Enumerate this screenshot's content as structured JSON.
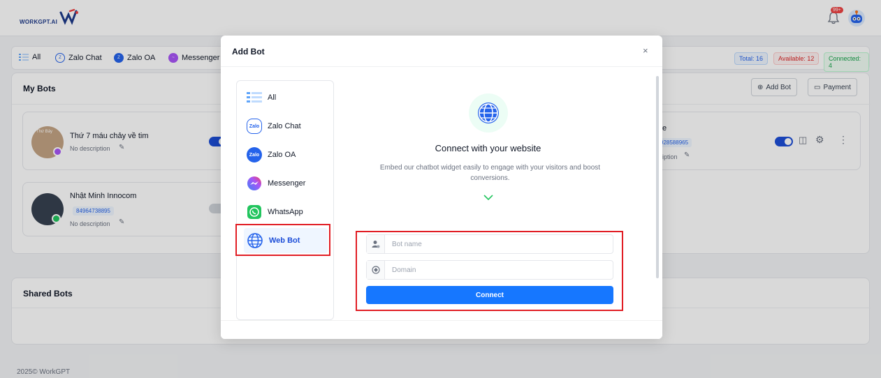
{
  "header": {
    "logo_text": "WORKGPT.AI",
    "notification_badge": "99+"
  },
  "filters": {
    "items": [
      {
        "label": "All",
        "icon": "list-icon"
      },
      {
        "label": "Zalo Chat",
        "icon": "zalo-chat-icon"
      },
      {
        "label": "Zalo OA",
        "icon": "zalo-oa-icon"
      },
      {
        "label": "Messenger",
        "icon": "messenger-icon"
      }
    ],
    "total": "Total: 16",
    "available": "Available: 12",
    "connected": "Connected: 4"
  },
  "my_bots": {
    "title": "My Bots",
    "add_bot_label": "Add Bot",
    "payment_label": "Payment",
    "bots": [
      {
        "name": "Thứ 7 máu chảy về tim",
        "desc": "No description",
        "avatar_text": "Thứ Bảy",
        "enabled": true
      },
      {
        "name": "Nhật Minh Innocom",
        "phone": "84964738895",
        "desc": "No description",
        "enabled": false
      },
      {
        "name": "e",
        "phone": "928588965",
        "desc": "iption",
        "enabled": true
      }
    ]
  },
  "shared_bots": {
    "title": "Shared Bots"
  },
  "footer": {
    "text": "2025© WorkGPT"
  },
  "modal": {
    "title": "Add Bot",
    "close": "×",
    "sidebar": [
      {
        "label": "All",
        "icon": "list-icon"
      },
      {
        "label": "Zalo Chat",
        "icon": "zalo-chat-icon",
        "icon_text": "Zalo"
      },
      {
        "label": "Zalo OA",
        "icon": "zalo-oa-icon",
        "icon_text": "Zalo"
      },
      {
        "label": "Messenger",
        "icon": "messenger-icon"
      },
      {
        "label": "WhatsApp",
        "icon": "whatsapp-icon"
      },
      {
        "label": "Web Bot",
        "icon": "globe-icon"
      }
    ],
    "selected": "Web Bot",
    "connect_title": "Connect with your website",
    "connect_desc": "Embed our chatbot widget easily to engage with your visitors and boost conversions.",
    "bot_name_placeholder": "Bot name",
    "domain_placeholder": "Domain",
    "connect_button": "Connect"
  },
  "colors": {
    "primary": "#1677ff",
    "highlight": "#e11d24",
    "green": "#16a34a"
  }
}
